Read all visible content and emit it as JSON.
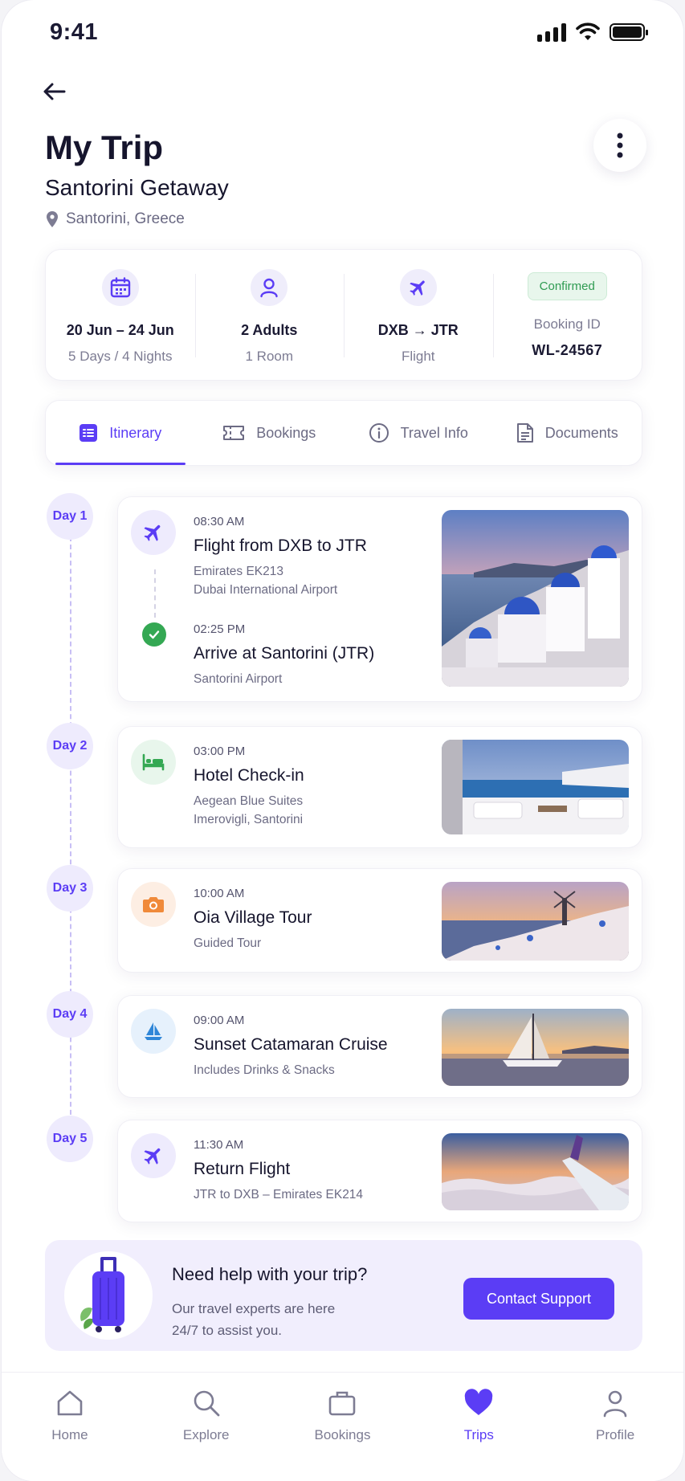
{
  "status_bar": {
    "time": "9:41"
  },
  "header": {
    "title": "My Trip",
    "trip_name": "Santorini Getaway",
    "location": "Santorini, Greece"
  },
  "summary": {
    "dates": "20 Jun – 24 Jun",
    "duration": "5 Days / 4 Nights",
    "guests": "2 Adults",
    "rooms": "1 Room",
    "route": "DXB → JTR",
    "transport": "Flight",
    "status": "Confirmed",
    "booking_label": "Booking ID",
    "booking_id": "WL-24567"
  },
  "tabs": [
    {
      "label": "Itinerary",
      "icon": "list-icon",
      "active": true
    },
    {
      "label": "Bookings",
      "icon": "ticket-icon",
      "active": false
    },
    {
      "label": "Travel Info",
      "icon": "info-icon",
      "active": false
    },
    {
      "label": "Documents",
      "icon": "document-icon",
      "active": false
    }
  ],
  "itinerary": [
    {
      "day": "Day 1",
      "events": [
        {
          "time": "08:30 AM",
          "title": "Flight from DXB to JTR",
          "lines": [
            "Emirates EK213",
            "Dubai International Airport"
          ],
          "icon": "plane-icon"
        },
        {
          "time": "02:25 PM",
          "title": "Arrive at Santorini (JTR)",
          "lines": [
            "Santorini Airport"
          ],
          "icon": "check-icon"
        }
      ],
      "photo": "santorini-blue-domes"
    },
    {
      "day": "Day 2",
      "events": [
        {
          "time": "03:00 PM",
          "title": "Hotel Check-in",
          "lines": [
            "Aegean Blue Suites",
            "Imerovigli, Santorini"
          ],
          "icon": "bed-icon"
        }
      ],
      "photo": "hotel-terrace"
    },
    {
      "day": "Day 3",
      "events": [
        {
          "time": "10:00 AM",
          "title": "Oia Village Tour",
          "lines": [
            "Guided Tour"
          ],
          "icon": "camera-icon"
        }
      ],
      "photo": "oia-sunset"
    },
    {
      "day": "Day 4",
      "events": [
        {
          "time": "09:00 AM",
          "title": "Sunset Catamaran Cruise",
          "lines": [
            "Includes Drinks & Snacks"
          ],
          "icon": "sailboat-icon"
        }
      ],
      "photo": "catamaran-sunset"
    },
    {
      "day": "Day 5",
      "events": [
        {
          "time": "11:30 AM",
          "title": "Return Flight",
          "lines": [
            "JTR to DXB  –  Emirates EK214"
          ],
          "icon": "plane-icon"
        }
      ],
      "photo": "airplane-wing"
    }
  ],
  "help": {
    "title": "Need help with your trip?",
    "text_line1": "Our travel experts are here",
    "text_line2": "24/7 to assist you.",
    "button": "Contact Support"
  },
  "nav": [
    {
      "label": "Home",
      "icon": "home-icon",
      "active": false
    },
    {
      "label": "Explore",
      "icon": "search-icon",
      "active": false
    },
    {
      "label": "Bookings",
      "icon": "briefcase-icon",
      "active": false
    },
    {
      "label": "Trips",
      "icon": "heart-icon",
      "active": true
    },
    {
      "label": "Profile",
      "icon": "user-icon",
      "active": false
    }
  ],
  "colors": {
    "accent": "#5b3df5",
    "accent_light": "#eeebfd",
    "success": "#34a853",
    "text_dark": "#16152d",
    "text_muted": "#7d7c93"
  }
}
